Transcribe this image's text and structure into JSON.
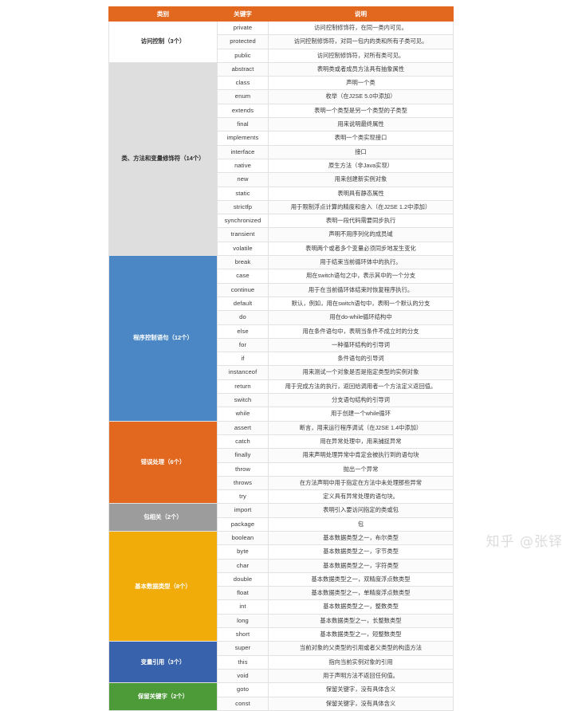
{
  "table": {
    "headers": [
      "类别",
      "关键字",
      "说明"
    ],
    "groups": [
      {
        "category": "访问控制（3个）",
        "color": "#ffffff",
        "color_class": "c-access",
        "rows": [
          {
            "keyword": "private",
            "desc": "访问控制修饰符，在同一类内可见。"
          },
          {
            "keyword": "protected",
            "desc": "访问控制修饰符，对同一包内的类和所有子类可见。"
          },
          {
            "keyword": "public",
            "desc": "访问控制修饰符，对所有类可见。"
          }
        ]
      },
      {
        "category": "类、方法和变量修饰符（14个）",
        "color": "#dedede",
        "color_class": "c-modifier",
        "rows": [
          {
            "keyword": "abstract",
            "desc": "表明类或者成员方法具有抽象属性"
          },
          {
            "keyword": "class",
            "desc": "声明一个类"
          },
          {
            "keyword": "enum",
            "desc": "枚举（在J2SE 5.0中添加）"
          },
          {
            "keyword": "extends",
            "desc": "表明一个类型是另一个类型的子类型"
          },
          {
            "keyword": "final",
            "desc": "用来说明最终属性"
          },
          {
            "keyword": "implements",
            "desc": "表明一个类实现接口"
          },
          {
            "keyword": "interface",
            "desc": "接口"
          },
          {
            "keyword": "native",
            "desc": "原生方法（非Java实现）"
          },
          {
            "keyword": "new",
            "desc": "用来创建新实例对象"
          },
          {
            "keyword": "static",
            "desc": "表明具有静态属性"
          },
          {
            "keyword": "strictfp",
            "desc": "用于限制浮点计算的精度和舍入（在J2SE 1.2中添加）"
          },
          {
            "keyword": "synchronized",
            "desc": "表明一段代码需要同步执行"
          },
          {
            "keyword": "transient",
            "desc": "声明不用序列化的成员域"
          },
          {
            "keyword": "volatile",
            "desc": "表明两个或者多个变量必须同步地发生变化"
          }
        ]
      },
      {
        "category": "程序控制语句（12个）",
        "color": "#4a87c4",
        "color_class": "c-control",
        "rows": [
          {
            "keyword": "break",
            "desc": "用于结束当前循环体中的执行。"
          },
          {
            "keyword": "case",
            "desc": "用在switch语句之中，表示其中的一个分支"
          },
          {
            "keyword": "continue",
            "desc": "用于在当前循环体结束时恢复程序执行。"
          },
          {
            "keyword": "default",
            "desc": "默认，例如，用在switch语句中，表明一个默认的分支"
          },
          {
            "keyword": "do",
            "desc": "用在do-while循环结构中"
          },
          {
            "keyword": "else",
            "desc": "用在条件语句中，表明当条件不成立时的分支"
          },
          {
            "keyword": "for",
            "desc": "一种循环结构的引导词"
          },
          {
            "keyword": "if",
            "desc": "条件语句的引导词"
          },
          {
            "keyword": "instanceof",
            "desc": "用来测试一个对象是否是指定类型的实例对象"
          },
          {
            "keyword": "return",
            "desc": "用于完成方法的执行，返回给调用者一个方法定义返回值。"
          },
          {
            "keyword": "switch",
            "desc": "分支语句结构的引导词"
          },
          {
            "keyword": "while",
            "desc": "用于创建一个while循环"
          }
        ]
      },
      {
        "category": "错误处理（6个）",
        "color": "#e2681f",
        "color_class": "c-error",
        "rows": [
          {
            "keyword": "assert",
            "desc": "断言，用来运行程序调试（在J2SE 1.4中添加）"
          },
          {
            "keyword": "catch",
            "desc": "用在异常处理中，用来捕捉异常"
          },
          {
            "keyword": "finally",
            "desc": "用来声明处理异常中肯定会被执行到的语句块"
          },
          {
            "keyword": "throw",
            "desc": "抛出一个异常"
          },
          {
            "keyword": "throws",
            "desc": "在方法声明中用于指定在方法中未处理那些异常"
          },
          {
            "keyword": "try",
            "desc": "定义具有异常处理的语句块。"
          }
        ]
      },
      {
        "category": "包相关（2个）",
        "color": "#9c9c9c",
        "color_class": "c-package",
        "rows": [
          {
            "keyword": "import",
            "desc": "表明引入要访问指定的类或包"
          },
          {
            "keyword": "package",
            "desc": "包"
          }
        ]
      },
      {
        "category": "基本数据类型（8个）",
        "color": "#f2ac09",
        "color_class": "c-datatype",
        "rows": [
          {
            "keyword": "boolean",
            "desc": "基本数据类型之一，布尔类型"
          },
          {
            "keyword": "byte",
            "desc": "基本数据类型之一，字节类型"
          },
          {
            "keyword": "char",
            "desc": "基本数据类型之一，字符类型"
          },
          {
            "keyword": "double",
            "desc": "基本数据类型之一，双精度浮点数类型"
          },
          {
            "keyword": "float",
            "desc": "基本数据类型之一，单精度浮点数类型"
          },
          {
            "keyword": "int",
            "desc": "基本数据类型之一，整数类型"
          },
          {
            "keyword": "long",
            "desc": "基本数据类型之一，长整数类型"
          },
          {
            "keyword": "short",
            "desc": "基本数据类型之一，短整数类型"
          }
        ]
      },
      {
        "category": "变量引用（3个）",
        "color": "#3862ab",
        "color_class": "c-varref",
        "rows": [
          {
            "keyword": "super",
            "desc": "当前对象的父类型的引用或者父类型的构造方法"
          },
          {
            "keyword": "this",
            "desc": "指向当前实例对象的引用"
          },
          {
            "keyword": "void",
            "desc": "用于声明方法不返回任何值。"
          }
        ]
      },
      {
        "category": "保留关键字（2个）",
        "color": "#4d9b38",
        "color_class": "c-reserved",
        "rows": [
          {
            "keyword": "goto",
            "desc": "保留关键字，没有具体含义"
          },
          {
            "keyword": "const",
            "desc": "保留关键字，没有具体含义"
          }
        ]
      }
    ]
  },
  "watermark": {
    "text": "知乎 @张铎"
  }
}
